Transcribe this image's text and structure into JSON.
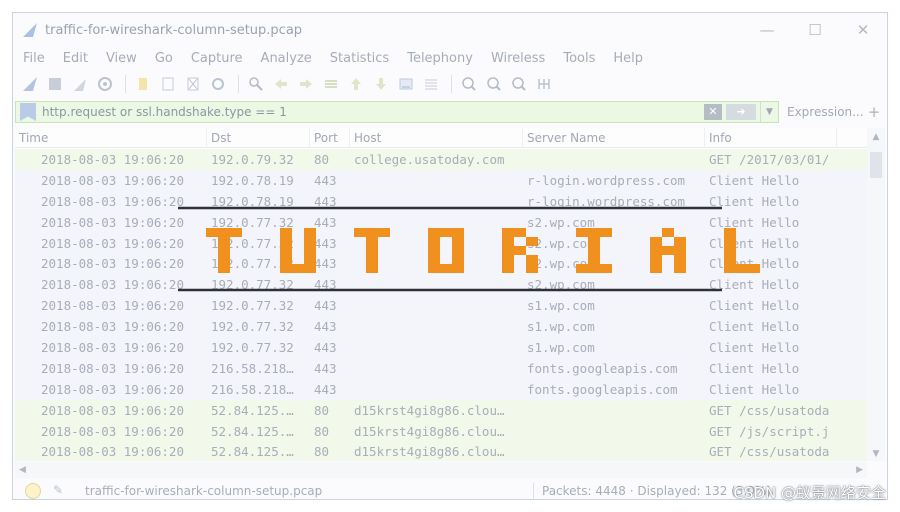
{
  "window": {
    "title": "traffic-for-wireshark-column-setup.pcap",
    "controls": {
      "minimize": "—",
      "maximize": "☐",
      "close": "✕"
    }
  },
  "menu": [
    "File",
    "Edit",
    "View",
    "Go",
    "Capture",
    "Analyze",
    "Statistics",
    "Telephony",
    "Wireless",
    "Tools",
    "Help"
  ],
  "toolbar_icons": [
    "shark-fin-start-icon",
    "stop-square-icon",
    "restart-fin-icon",
    "capture-options-icon",
    "open-file-icon",
    "file-icon",
    "close-file-icon",
    "reload-icon",
    "find-icon",
    "back-arrow-icon",
    "forward-arrow-icon",
    "go-to-packet-icon",
    "first-packet-icon",
    "last-packet-icon",
    "autoscroll-icon",
    "colorize-icon",
    "zoom-in-icon",
    "zoom-out-icon",
    "zoom-normal-icon",
    "resize-columns-icon"
  ],
  "filter": {
    "value": "http.request or ssl.handshake.type == 1",
    "expression_label": "Expression...",
    "add_label": "+"
  },
  "columns": [
    "Time",
    "Dst",
    "Port",
    "Host",
    "Server Name",
    "Info"
  ],
  "rows": [
    {
      "type": "http",
      "time": "2018-08-03 19:06:20",
      "dst": "192.0.79.32",
      "port": "80",
      "host": "college.usatoday.com",
      "sn": "",
      "info": "GET /2017/03/01/"
    },
    {
      "type": "tls",
      "time": "2018-08-03 19:06:20",
      "dst": "192.0.78.19",
      "port": "443",
      "host": "",
      "sn": "r-login.wordpress.com",
      "info": "Client Hello"
    },
    {
      "type": "tls",
      "time": "2018-08-03 19:06:20",
      "dst": "192.0.78.19",
      "port": "443",
      "host": "",
      "sn": "r-login.wordpress.com",
      "info": "Client Hello"
    },
    {
      "type": "tls",
      "time": "2018-08-03 19:06:20",
      "dst": "192.0.77.32",
      "port": "443",
      "host": "",
      "sn": "s2.wp.com",
      "info": "Client Hello"
    },
    {
      "type": "tls",
      "time": "2018-08-03 19:06:20",
      "dst": "192.0.77.32",
      "port": "443",
      "host": "",
      "sn": "s2.wp.com",
      "info": "Client Hello"
    },
    {
      "type": "tls",
      "time": "2018-08-03 19:06:20",
      "dst": "192.0.77.32",
      "port": "443",
      "host": "",
      "sn": "s2.wp.com",
      "info": "Client Hello"
    },
    {
      "type": "tls",
      "time": "2018-08-03 19:06:20",
      "dst": "192.0.77.32",
      "port": "443",
      "host": "",
      "sn": "s2.wp.com",
      "info": "Client Hello"
    },
    {
      "type": "tls",
      "time": "2018-08-03 19:06:20",
      "dst": "192.0.77.32",
      "port": "443",
      "host": "",
      "sn": "s1.wp.com",
      "info": "Client Hello"
    },
    {
      "type": "tls",
      "time": "2018-08-03 19:06:20",
      "dst": "192.0.77.32",
      "port": "443",
      "host": "",
      "sn": "s1.wp.com",
      "info": "Client Hello"
    },
    {
      "type": "tls",
      "time": "2018-08-03 19:06:20",
      "dst": "192.0.77.32",
      "port": "443",
      "host": "",
      "sn": "s1.wp.com",
      "info": "Client Hello"
    },
    {
      "type": "tls",
      "time": "2018-08-03 19:06:20",
      "dst": "216.58.218…",
      "port": "443",
      "host": "",
      "sn": "fonts.googleapis.com",
      "info": "Client Hello"
    },
    {
      "type": "tls",
      "time": "2018-08-03 19:06:20",
      "dst": "216.58.218…",
      "port": "443",
      "host": "",
      "sn": "fonts.googleapis.com",
      "info": "Client Hello"
    },
    {
      "type": "http",
      "time": "2018-08-03 19:06:20",
      "dst": "52.84.125.…",
      "port": "80",
      "host": "d15krst4gi8g86.clou…",
      "sn": "",
      "info": "GET /css/usatoda"
    },
    {
      "type": "http",
      "time": "2018-08-03 19:06:20",
      "dst": "52.84.125.…",
      "port": "80",
      "host": "d15krst4gi8g86.clou…",
      "sn": "",
      "info": "GET /js/script.j"
    },
    {
      "type": "http",
      "time": "2018-08-03 19:06:20",
      "dst": "52.84.125.…",
      "port": "80",
      "host": "d15krst4gi8g86.clou…",
      "sn": "",
      "info": "GET /css/usatoda"
    }
  ],
  "status": {
    "file": "traffic-for-wireshark-column-setup.pcap",
    "packets": "Packets: 4448 · Displayed: 132 (3.0%)"
  },
  "overlay": {
    "text": "TUTORIAL",
    "color": "#f0901e"
  },
  "watermark": "CSDN @蚁景网络安全"
}
